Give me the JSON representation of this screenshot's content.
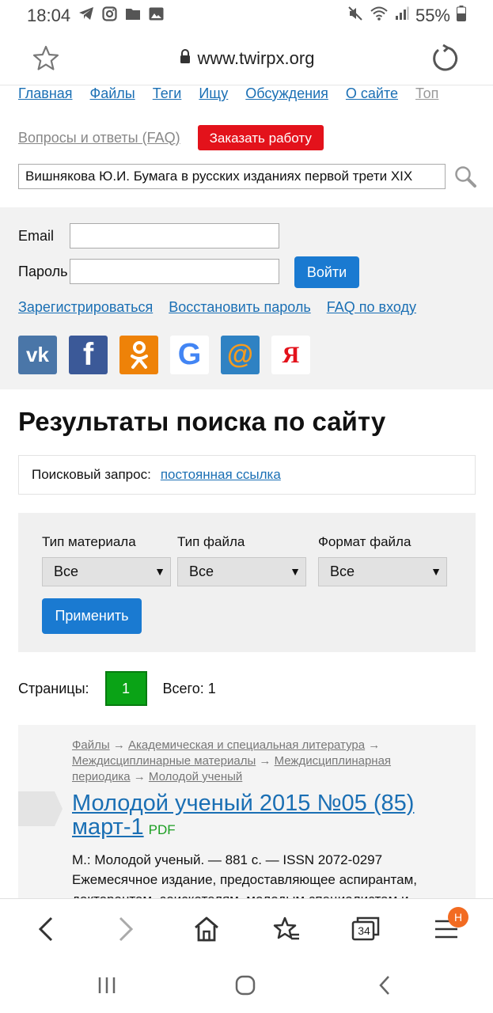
{
  "status": {
    "time": "18:04",
    "battery": "55%"
  },
  "browser": {
    "url": "www.twirpx.org",
    "tab_count": "34",
    "menu_badge": "H"
  },
  "topnav": {
    "items": [
      "Главная",
      "Файлы",
      "Теги",
      "Ищу",
      "Обсуждения",
      "О сайте",
      "Топ"
    ]
  },
  "row2": {
    "faq": "Вопросы и ответы (FAQ)",
    "order": "Заказать работу"
  },
  "search": {
    "value": "Вишнякова Ю.И. Бумага в русских изданиях первой трети XIX"
  },
  "login": {
    "email_label": "Email",
    "password_label": "Пароль",
    "submit": "Войти",
    "register": "Зарегистрироваться",
    "restore": "Восстановить пароль",
    "faq": "FAQ по входу"
  },
  "socials": {
    "vk": "vk",
    "fb": "f",
    "ok": "ok",
    "g": "G",
    "mail": "@",
    "ya": "Я"
  },
  "results": {
    "title": "Результаты поиска по сайту",
    "query_label": "Поисковый запрос:",
    "permalink": "постоянная ссылка"
  },
  "filters": {
    "material_label": "Тип материала",
    "material_value": "Все",
    "filetype_label": "Тип файла",
    "filetype_value": "Все",
    "format_label": "Формат файла",
    "format_value": "Все",
    "apply": "Применить"
  },
  "pager": {
    "label": "Страницы:",
    "current": "1",
    "total": "Всего: 1"
  },
  "result": {
    "crumbs": [
      "Файлы",
      "Академическая и специальная литература",
      "Междисциплинарные материалы",
      "Междисциплинарная периодика",
      "Молодой ученый"
    ],
    "sep": "→",
    "title": "Молодой ученый 2015 №05 (85) март-1",
    "format": "PDF",
    "meta": "М.: Молодой ученый. — 881 с. — ISSN 2072-0297",
    "desc": "Ежемесячное издание, предоставляющее аспирантам, докторантам, соискателям, молодым специалистам и"
  }
}
